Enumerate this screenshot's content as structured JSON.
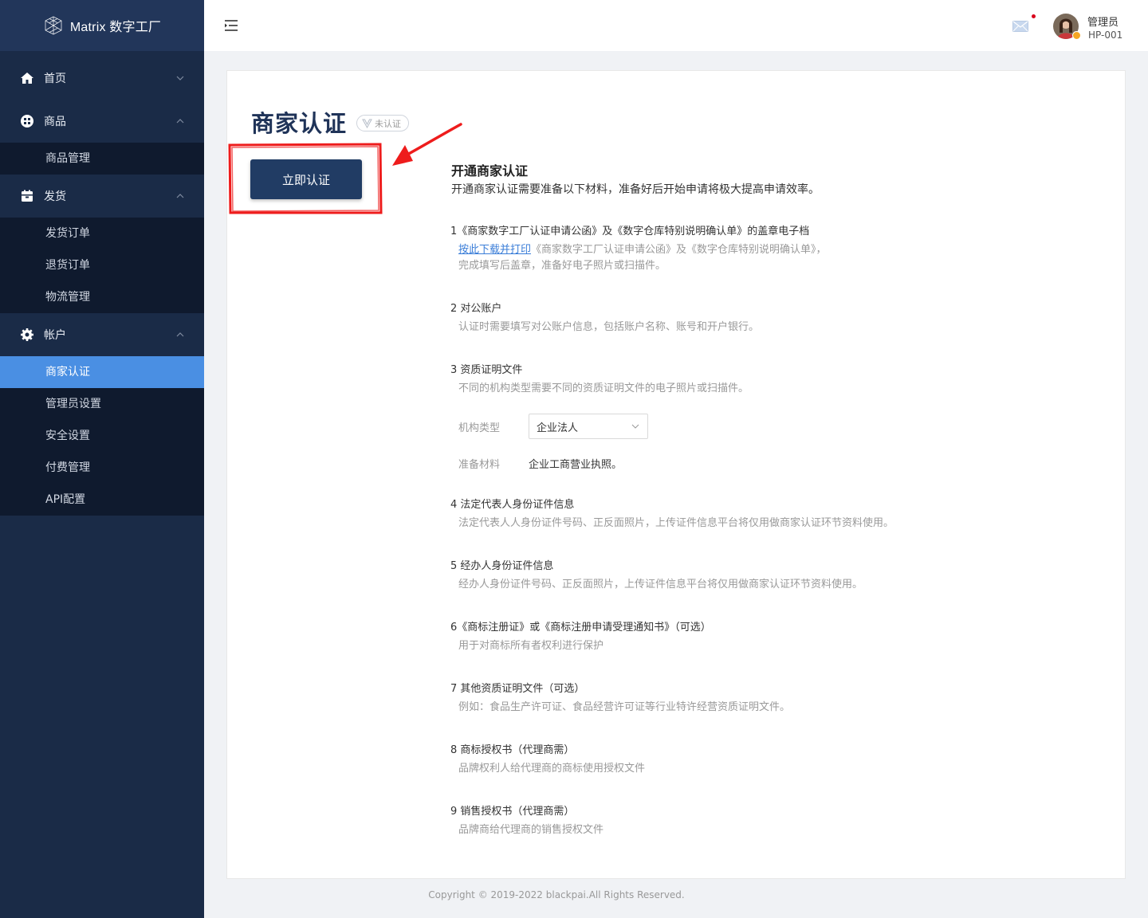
{
  "app": {
    "logo_text": "Matrix 数字工厂"
  },
  "sidebar": {
    "groups": [
      {
        "label": "首页",
        "icon": "home-icon",
        "expanded": false,
        "items": []
      },
      {
        "label": "商品",
        "icon": "grid-icon",
        "expanded": true,
        "items": [
          "商品管理"
        ]
      },
      {
        "label": "发货",
        "icon": "box-icon",
        "expanded": true,
        "items": [
          "发货订单",
          "退货订单",
          "物流管理"
        ]
      },
      {
        "label": "帐户",
        "icon": "gear-icon",
        "expanded": true,
        "items": [
          "商家认证",
          "管理员设置",
          "安全设置",
          "付费管理",
          "API配置"
        ]
      }
    ],
    "active_item": "商家认证",
    "active_color": "#4a8fe3"
  },
  "header": {
    "user_name": "管理员",
    "user_id": "HP-001",
    "mail_has_unread": true
  },
  "page": {
    "title": "商家认证",
    "status_badge": "未认证",
    "cta_label": "立即认证",
    "intro_title": "开通商家认证",
    "intro_desc": "开通商家认证需要准备以下材料，准备好后开始申请将极大提高申请效率。",
    "steps": [
      {
        "title": "1《商家数字工厂认证申请公函》及《数字仓库特别说明确认单》的盖章电子档",
        "link": "按此下载并打印",
        "desc_after_link": "《商家数字工厂认证申请公函》及《数字仓库特别说明确认单》，",
        "desc2": "完成填写后盖章，准备好电子照片或扫描件。"
      },
      {
        "title": "2 对公账户",
        "desc": "认证时需要填写对公账户信息，包括账户名称、账号和开户银行。"
      },
      {
        "title": "3 资质证明文件",
        "desc": "不同的机构类型需要不同的资质证明文件的电子照片或扫描件。"
      },
      {
        "title": "4 法定代表人身份证件信息",
        "desc": "法定代表人人身份证件号码、正反面照片，上传证件信息平台将仅用做商家认证环节资料使用。"
      },
      {
        "title": "5 经办人身份证件信息",
        "desc": "经办人身份证件号码、正反面照片，上传证件信息平台将仅用做商家认证环节资料使用。"
      },
      {
        "title": "6《商标注册证》或《商标注册申请受理通知书》（可选）",
        "desc": "用于对商标所有者权利进行保护"
      },
      {
        "title": "7 其他资质证明文件（可选）",
        "desc": "例如：食品生产许可证、食品经营许可证等行业特许经营资质证明文件。"
      },
      {
        "title": "8 商标授权书（代理商需）",
        "desc": "品牌权利人给代理商的商标使用授权文件"
      },
      {
        "title": "9 销售授权书（代理商需）",
        "desc": "品牌商给代理商的销售授权文件"
      }
    ],
    "org_type_label": "机构类型",
    "org_type_value": "企业法人",
    "materials_label": "准备材料",
    "materials_value": "企业工商营业执照。"
  },
  "footer": {
    "copyright": "Copyright © 2019-2022 blackpai.All Rights Reserved."
  }
}
